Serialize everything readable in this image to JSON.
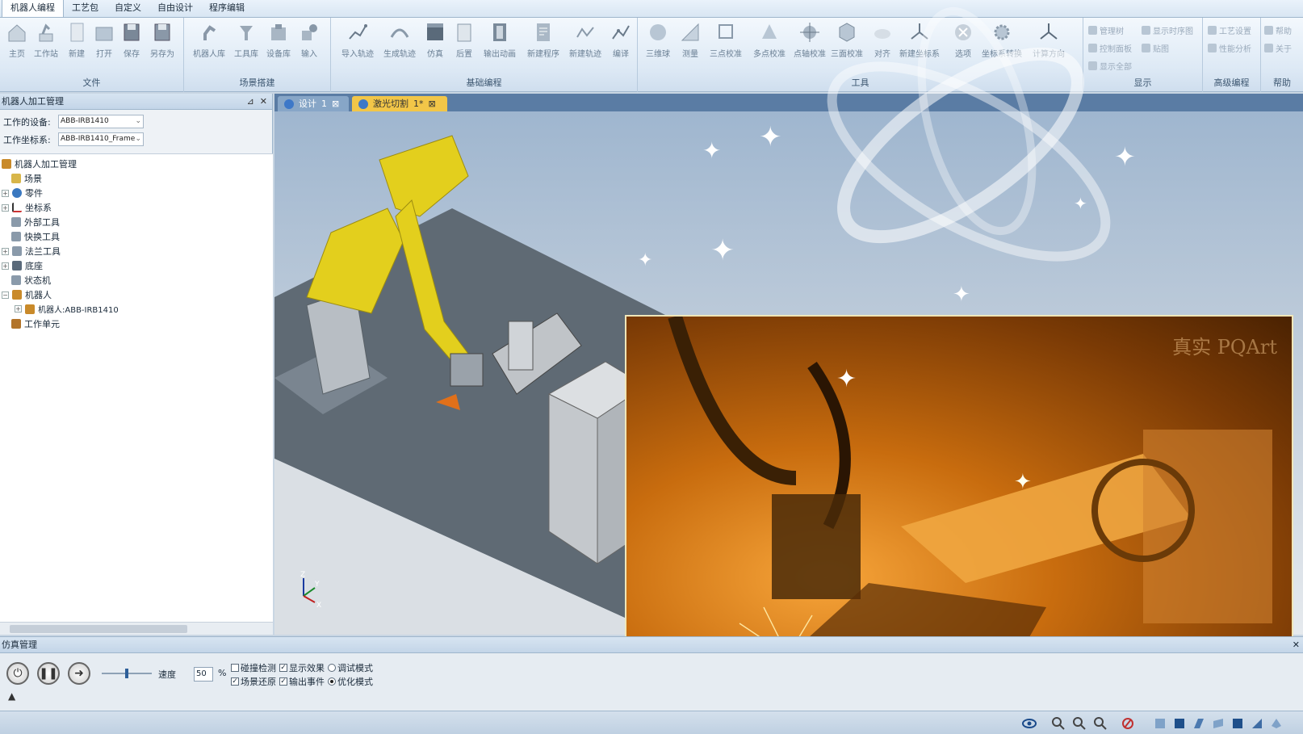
{
  "menu": {
    "tabs": [
      "机器人编程",
      "工艺包",
      "自定义",
      "自由设计",
      "程序编辑"
    ],
    "active_index": 0
  },
  "ribbon": {
    "groups": {
      "file": "文件",
      "scene": "场景搭建",
      "basic": "基础编程",
      "tools": "工具",
      "display": "显示",
      "advanced": "高级编程",
      "help": "帮助"
    },
    "file_buttons": [
      "主页",
      "工作站",
      "新建",
      "打开",
      "保存",
      "另存为"
    ],
    "scene_buttons": [
      "机器人库",
      "工具库",
      "设备库",
      "输入"
    ],
    "basic_buttons": [
      "导入轨迹",
      "生成轨迹",
      "仿真",
      "后置",
      "输出动画",
      "新建程序",
      "新建轨迹",
      "编译"
    ],
    "tool_buttons": [
      "三维球",
      "测量",
      "三点校准",
      "多点校准",
      "点轴校准",
      "三面校准",
      "对齐",
      "新建坐标系",
      "选项",
      "坐标系转换",
      "计算方向"
    ],
    "display_buttons": [
      "管理树",
      "显示时序图",
      "控制面板",
      "贴图",
      "显示全部"
    ],
    "advanced_buttons": [
      "工艺设置",
      "性能分析"
    ],
    "help_buttons": [
      "帮助",
      "关于"
    ]
  },
  "left_panel": {
    "title": "机器人加工管理",
    "pin": "⊿",
    "close": "✕",
    "device_label": "工作的设备:",
    "device_value": "ABB-IRB1410",
    "frame_label": "工作坐标系:",
    "frame_value": "ABB-IRB1410_Frame",
    "tree": [
      "机器人加工管理",
      "场景",
      "零件",
      "坐标系",
      "外部工具",
      "快换工具",
      "法兰工具",
      "底座",
      "状态机",
      "机器人",
      "机器人:ABB-IRB1410",
      "工作单元"
    ]
  },
  "doc_tabs": [
    {
      "label": "设计",
      "index": "1"
    },
    {
      "label": "激光切割",
      "index": "1*"
    }
  ],
  "viewport": {
    "axis_x": "X",
    "axis_y": "Y",
    "axis_z": "Z"
  },
  "video": {
    "watermark": "真实 PQArt"
  },
  "sim_panel": {
    "title": "仿真管理",
    "close": "✕",
    "speed_label": "速度",
    "speed_value": "50",
    "percent": "%",
    "speed_level": 0.5,
    "collision": "碰撞检测",
    "show_effect": "显示效果",
    "debug_mode": "调试模式",
    "scene_restore": "场景还原",
    "output_event": "输出事件",
    "optimize_mode": "优化模式"
  },
  "colors": {
    "robot_yellow": "#e3cf1d",
    "active_tab": "#f2c648",
    "video_orange": "#e8881c"
  }
}
